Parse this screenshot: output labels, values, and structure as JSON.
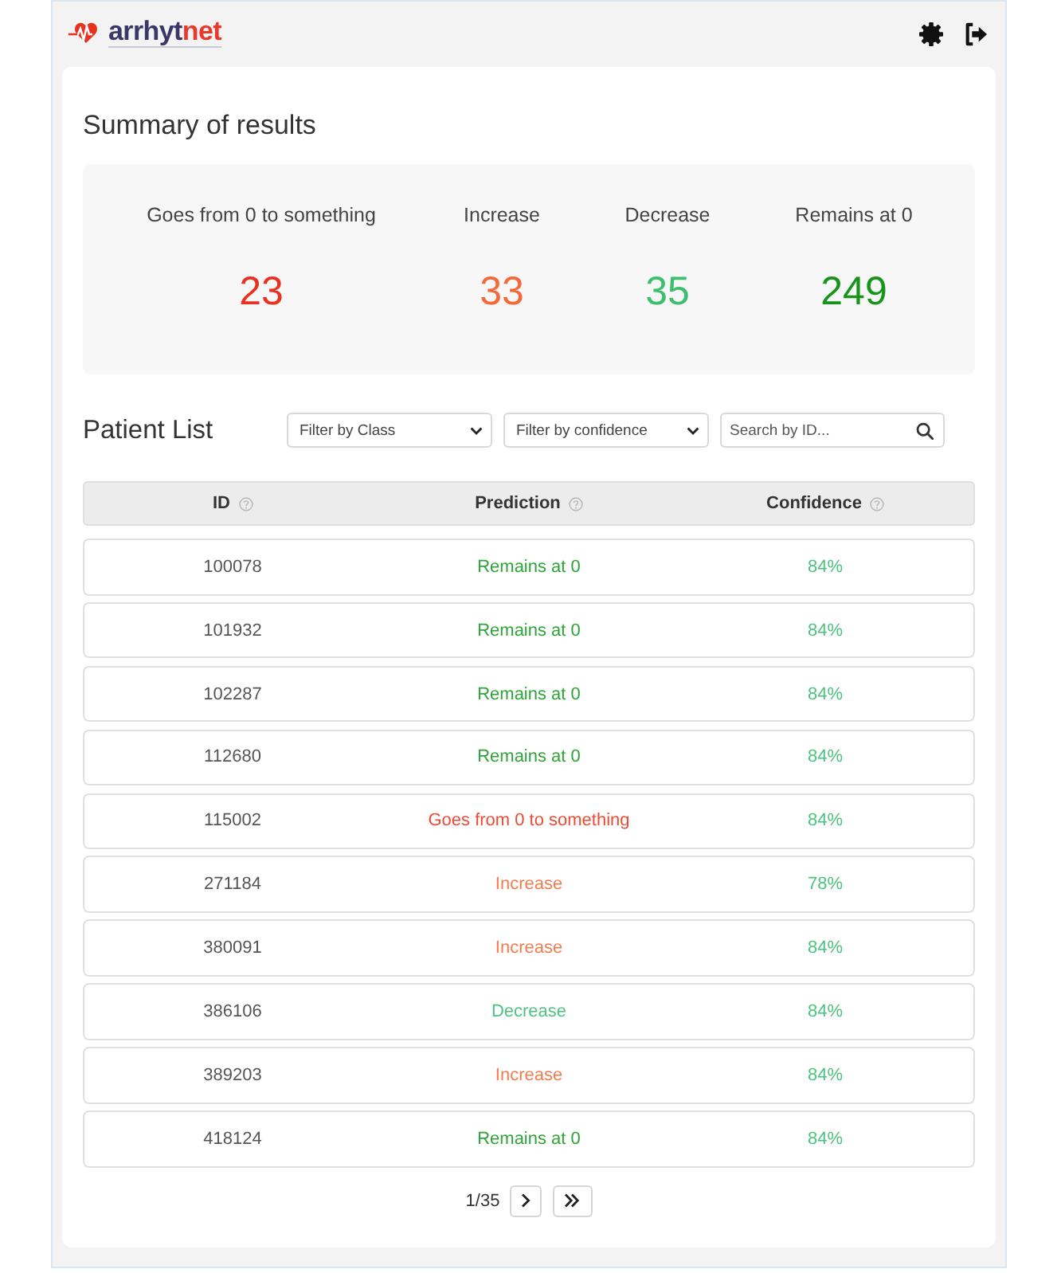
{
  "header": {
    "logo": {
      "brand": "arrhyt",
      "brand_accent": "net"
    }
  },
  "summary": {
    "title": "Summary of results",
    "stats": [
      {
        "label": "Goes from 0 to something",
        "value": "23",
        "color": "#e8321f"
      },
      {
        "label": "Increase",
        "value": "33",
        "color": "#f5683a"
      },
      {
        "label": "Decrease",
        "value": "35",
        "color": "#3cbf6e"
      },
      {
        "label": "Remains at 0",
        "value": "249",
        "color": "#17941a"
      }
    ]
  },
  "patient_list": {
    "title": "Patient List",
    "filters": [
      {
        "label": "Filter by Class"
      },
      {
        "label": "Filter by confidence"
      }
    ],
    "search": {
      "placeholder": "Search by ID..."
    },
    "table": {
      "columns": [
        {
          "label": "ID"
        },
        {
          "label": "Prediction"
        },
        {
          "label": "Confidence"
        }
      ],
      "rows": [
        {
          "id": "100078",
          "prediction": {
            "text": "Remains at 0",
            "color": "#2ea43a"
          },
          "confidence": "84%"
        },
        {
          "id": "101932",
          "prediction": {
            "text": "Remains at 0",
            "color": "#2ea43a"
          },
          "confidence": "84%"
        },
        {
          "id": "102287",
          "prediction": {
            "text": "Remains at 0",
            "color": "#2ea43a"
          },
          "confidence": "84%"
        },
        {
          "id": "112680",
          "prediction": {
            "text": "Remains at 0",
            "color": "#2ea43a"
          },
          "confidence": "84%"
        },
        {
          "id": "115002",
          "prediction": {
            "text": "Goes from 0 to something",
            "color": "#ee4a35"
          },
          "confidence": "84%"
        },
        {
          "id": "271184",
          "prediction": {
            "text": "Increase",
            "color": "#f47c4e"
          },
          "confidence": "78%"
        },
        {
          "id": "380091",
          "prediction": {
            "text": "Increase",
            "color": "#f47c4e"
          },
          "confidence": "84%"
        },
        {
          "id": "386106",
          "prediction": {
            "text": "Decrease",
            "color": "#4fc383"
          },
          "confidence": "84%"
        },
        {
          "id": "389203",
          "prediction": {
            "text": "Increase",
            "color": "#f47c4e"
          },
          "confidence": "84%"
        },
        {
          "id": "418124",
          "prediction": {
            "text": "Remains at 0",
            "color": "#2ea43a"
          },
          "confidence": "84%"
        }
      ]
    },
    "pagination": {
      "page": "1/35"
    }
  }
}
